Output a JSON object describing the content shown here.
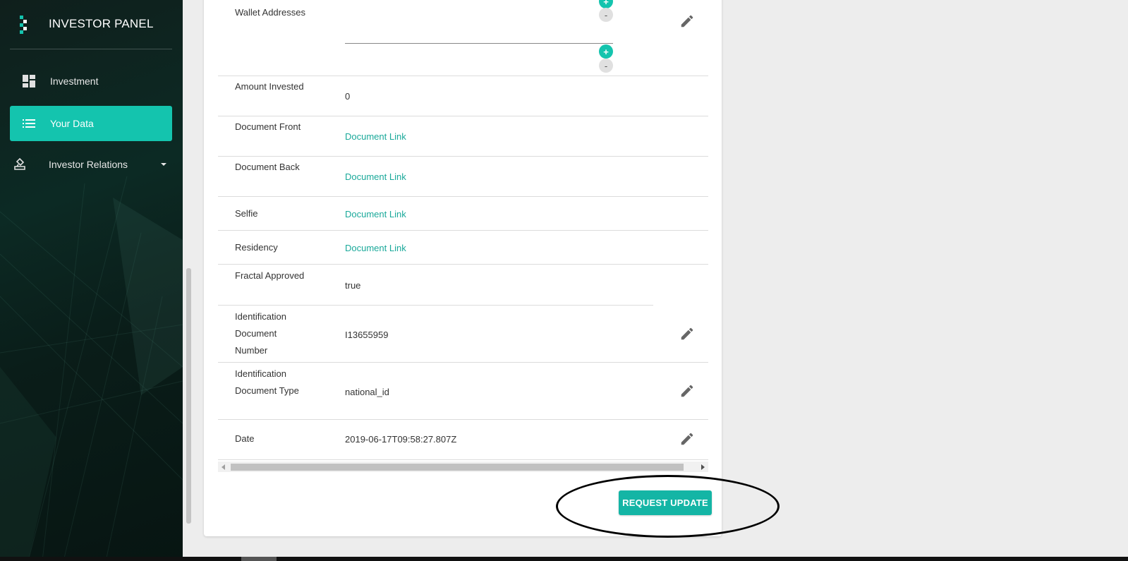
{
  "sidebar": {
    "brand_title": "INVESTOR PANEL",
    "items": [
      {
        "label": "Investment",
        "icon": "dashboard-icon",
        "active": false
      },
      {
        "label": "Your Data",
        "icon": "list-icon",
        "active": true
      },
      {
        "label": "Investor Relations",
        "icon": "stamp-icon",
        "active": false,
        "has_dropdown": true
      }
    ]
  },
  "table": {
    "rows": [
      {
        "label": "Wallet Addresses",
        "value": ""
      },
      {
        "label": "Amount Invested",
        "value": "0"
      },
      {
        "label": "Document Front",
        "value": "Document Link"
      },
      {
        "label": "Document Back",
        "value": "Document Link"
      },
      {
        "label": "Selfie",
        "value": "Document Link"
      },
      {
        "label": "Residency",
        "value": "Document Link"
      },
      {
        "label": "Fractal Approved",
        "value": "true"
      },
      {
        "label": "Identification Document Number",
        "value": "I13655959"
      },
      {
        "label": "Identification Document Type",
        "value": "national_id"
      },
      {
        "label": "Date",
        "value": "2019-06-17T09:58:27.807Z"
      }
    ],
    "wallet_controls": {
      "add": "+",
      "remove": "-"
    }
  },
  "actions": {
    "request_update_label": "REQUEST UPDATE"
  },
  "colors": {
    "accent": "#14c4ae",
    "link": "#1aa99a",
    "button": "#14b5a5"
  }
}
